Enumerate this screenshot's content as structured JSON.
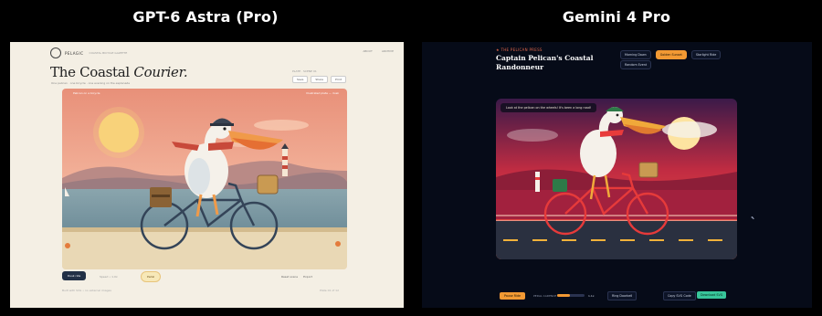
{
  "labels": {
    "left": "GPT-6 Astra (Pro)",
    "right": "Gemini 4 Pro"
  },
  "left": {
    "brand": "PELAGIC",
    "brand_sub": "COASTAL BICYCLE GAZETTE",
    "topnav": [
      "ABOUT",
      "ARCHIVE"
    ],
    "title_main": "The Coastal ",
    "title_italic": "Courier.",
    "subtitle": "One pelican · one bicycle · one evening on the esplanade",
    "side_caption": "PLATE · SCENE 01",
    "side_buttons": [
      "Save",
      "Share",
      "Print"
    ],
    "art_caption_left": "Pelican on a bicycle",
    "art_caption_right": "Illustrated plate — dusk",
    "primary_button": "Dusk ride",
    "pill_button": "Pedal",
    "meta": "Speed • 1.0x",
    "right_meta": [
      "Reset scene",
      "Export"
    ],
    "foot_left": "Built with SVG • no external images",
    "foot_right": "Plate 01 of 12"
  },
  "right": {
    "eyebrow": "★ THE PELICAN PRESS",
    "title": "Captain Pelican's Coastal Randonneur",
    "chips": [
      {
        "label": "Morning Dawn",
        "on": false
      },
      {
        "label": "Golden Sunset",
        "on": true
      },
      {
        "label": "Starlight Ride",
        "on": false
      }
    ],
    "chip_row2": "Random Event",
    "banner": "Look at the pelican on the wheels! It's been a long road!",
    "play_label": "Pause Ride",
    "speed_caption": "PEDAL CADENCE",
    "speed_value": "1.1x",
    "speed_fraction": 0.45,
    "wheel_label": "Ring Doorbell",
    "copy_label": "Copy SVG Code",
    "download_label": "Download SVG"
  },
  "colors": {
    "left_bg": "#f4efe4",
    "right_bg": "#060b18",
    "accent_orange": "#f29933",
    "accent_green": "#38c59a",
    "left_primary": "#223046"
  }
}
